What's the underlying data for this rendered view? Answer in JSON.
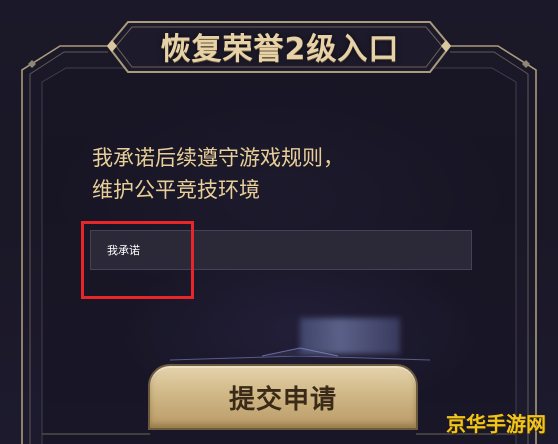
{
  "banner": {
    "title": "恢复荣誉2级入口"
  },
  "pledge": {
    "line1": "我承诺后续遵守游戏规则，",
    "line2": "维护公平竞技环境"
  },
  "input": {
    "value": "我承诺"
  },
  "submit": {
    "label": "提交申请"
  },
  "watermark": {
    "text": "京华手游网"
  },
  "colors": {
    "gold_text": "#e8cf97",
    "frame_gold": "#a99b7c",
    "button_gold": "#d0b887",
    "highlight_red": "#e8262a"
  }
}
